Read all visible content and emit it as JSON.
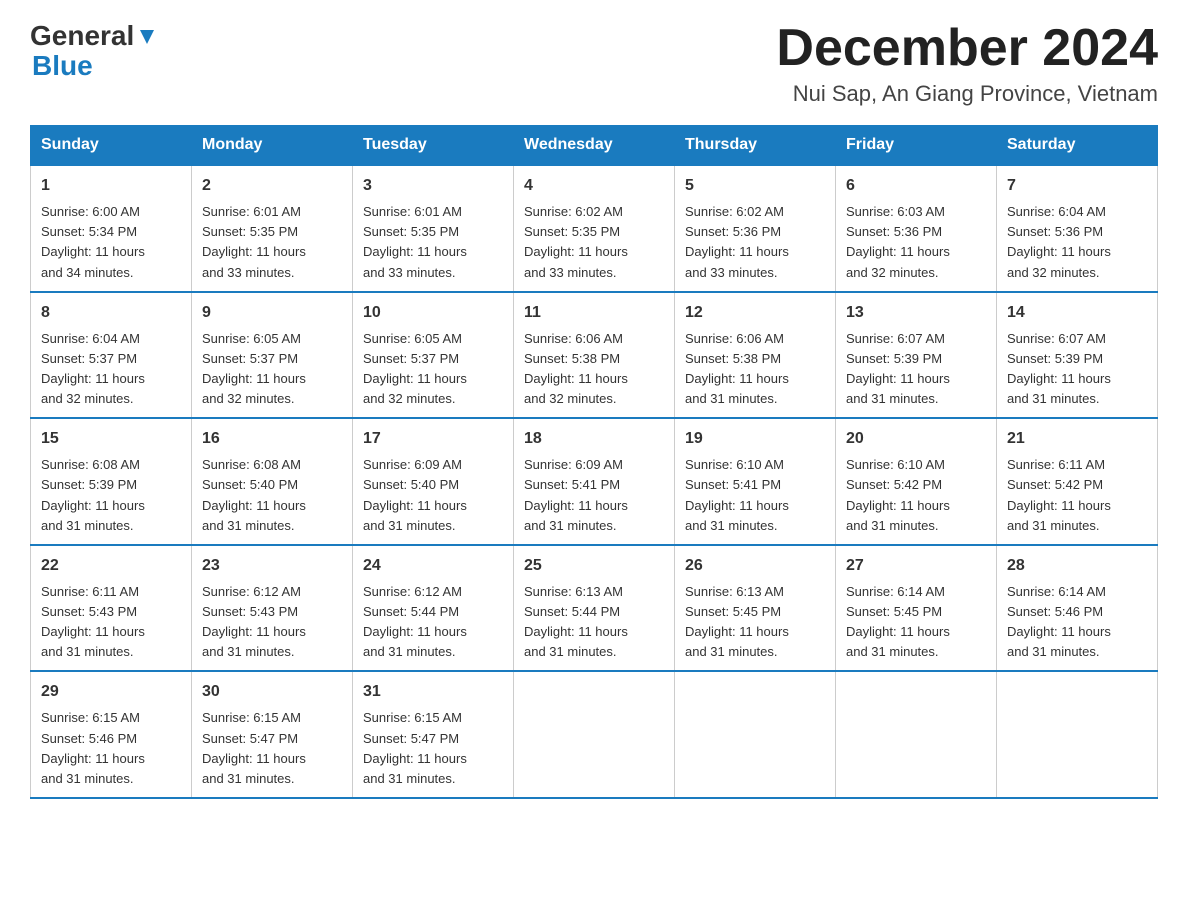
{
  "header": {
    "logo_general": "General",
    "logo_blue": "Blue",
    "title": "December 2024",
    "subtitle": "Nui Sap, An Giang Province, Vietnam"
  },
  "days_of_week": [
    "Sunday",
    "Monday",
    "Tuesday",
    "Wednesday",
    "Thursday",
    "Friday",
    "Saturday"
  ],
  "weeks": [
    [
      {
        "day": "1",
        "sunrise": "6:00 AM",
        "sunset": "5:34 PM",
        "daylight": "11 hours and 34 minutes."
      },
      {
        "day": "2",
        "sunrise": "6:01 AM",
        "sunset": "5:35 PM",
        "daylight": "11 hours and 33 minutes."
      },
      {
        "day": "3",
        "sunrise": "6:01 AM",
        "sunset": "5:35 PM",
        "daylight": "11 hours and 33 minutes."
      },
      {
        "day": "4",
        "sunrise": "6:02 AM",
        "sunset": "5:35 PM",
        "daylight": "11 hours and 33 minutes."
      },
      {
        "day": "5",
        "sunrise": "6:02 AM",
        "sunset": "5:36 PM",
        "daylight": "11 hours and 33 minutes."
      },
      {
        "day": "6",
        "sunrise": "6:03 AM",
        "sunset": "5:36 PM",
        "daylight": "11 hours and 32 minutes."
      },
      {
        "day": "7",
        "sunrise": "6:04 AM",
        "sunset": "5:36 PM",
        "daylight": "11 hours and 32 minutes."
      }
    ],
    [
      {
        "day": "8",
        "sunrise": "6:04 AM",
        "sunset": "5:37 PM",
        "daylight": "11 hours and 32 minutes."
      },
      {
        "day": "9",
        "sunrise": "6:05 AM",
        "sunset": "5:37 PM",
        "daylight": "11 hours and 32 minutes."
      },
      {
        "day": "10",
        "sunrise": "6:05 AM",
        "sunset": "5:37 PM",
        "daylight": "11 hours and 32 minutes."
      },
      {
        "day": "11",
        "sunrise": "6:06 AM",
        "sunset": "5:38 PM",
        "daylight": "11 hours and 32 minutes."
      },
      {
        "day": "12",
        "sunrise": "6:06 AM",
        "sunset": "5:38 PM",
        "daylight": "11 hours and 31 minutes."
      },
      {
        "day": "13",
        "sunrise": "6:07 AM",
        "sunset": "5:39 PM",
        "daylight": "11 hours and 31 minutes."
      },
      {
        "day": "14",
        "sunrise": "6:07 AM",
        "sunset": "5:39 PM",
        "daylight": "11 hours and 31 minutes."
      }
    ],
    [
      {
        "day": "15",
        "sunrise": "6:08 AM",
        "sunset": "5:39 PM",
        "daylight": "11 hours and 31 minutes."
      },
      {
        "day": "16",
        "sunrise": "6:08 AM",
        "sunset": "5:40 PM",
        "daylight": "11 hours and 31 minutes."
      },
      {
        "day": "17",
        "sunrise": "6:09 AM",
        "sunset": "5:40 PM",
        "daylight": "11 hours and 31 minutes."
      },
      {
        "day": "18",
        "sunrise": "6:09 AM",
        "sunset": "5:41 PM",
        "daylight": "11 hours and 31 minutes."
      },
      {
        "day": "19",
        "sunrise": "6:10 AM",
        "sunset": "5:41 PM",
        "daylight": "11 hours and 31 minutes."
      },
      {
        "day": "20",
        "sunrise": "6:10 AM",
        "sunset": "5:42 PM",
        "daylight": "11 hours and 31 minutes."
      },
      {
        "day": "21",
        "sunrise": "6:11 AM",
        "sunset": "5:42 PM",
        "daylight": "11 hours and 31 minutes."
      }
    ],
    [
      {
        "day": "22",
        "sunrise": "6:11 AM",
        "sunset": "5:43 PM",
        "daylight": "11 hours and 31 minutes."
      },
      {
        "day": "23",
        "sunrise": "6:12 AM",
        "sunset": "5:43 PM",
        "daylight": "11 hours and 31 minutes."
      },
      {
        "day": "24",
        "sunrise": "6:12 AM",
        "sunset": "5:44 PM",
        "daylight": "11 hours and 31 minutes."
      },
      {
        "day": "25",
        "sunrise": "6:13 AM",
        "sunset": "5:44 PM",
        "daylight": "11 hours and 31 minutes."
      },
      {
        "day": "26",
        "sunrise": "6:13 AM",
        "sunset": "5:45 PM",
        "daylight": "11 hours and 31 minutes."
      },
      {
        "day": "27",
        "sunrise": "6:14 AM",
        "sunset": "5:45 PM",
        "daylight": "11 hours and 31 minutes."
      },
      {
        "day": "28",
        "sunrise": "6:14 AM",
        "sunset": "5:46 PM",
        "daylight": "11 hours and 31 minutes."
      }
    ],
    [
      {
        "day": "29",
        "sunrise": "6:15 AM",
        "sunset": "5:46 PM",
        "daylight": "11 hours and 31 minutes."
      },
      {
        "day": "30",
        "sunrise": "6:15 AM",
        "sunset": "5:47 PM",
        "daylight": "11 hours and 31 minutes."
      },
      {
        "day": "31",
        "sunrise": "6:15 AM",
        "sunset": "5:47 PM",
        "daylight": "11 hours and 31 minutes."
      },
      null,
      null,
      null,
      null
    ]
  ],
  "labels": {
    "sunrise": "Sunrise:",
    "sunset": "Sunset:",
    "daylight": "Daylight:"
  }
}
